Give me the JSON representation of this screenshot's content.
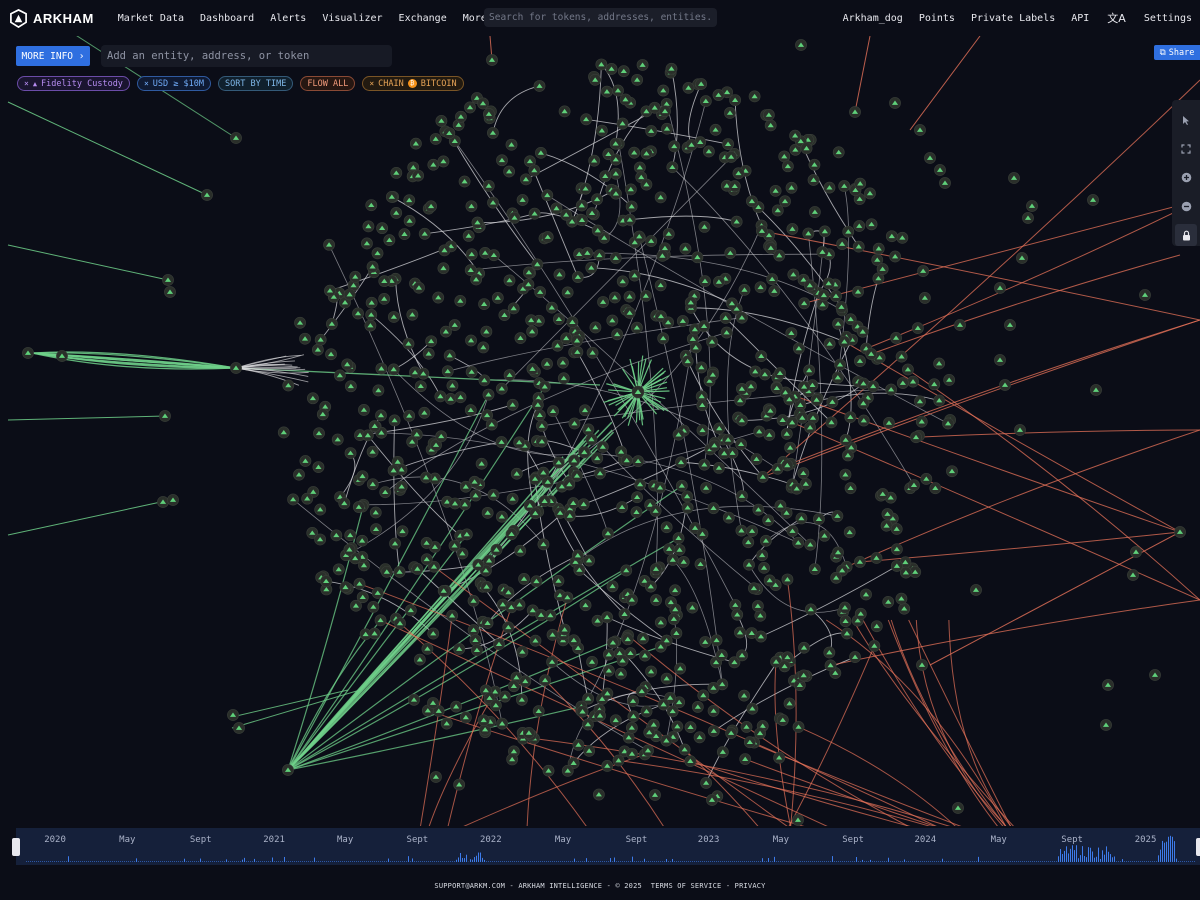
{
  "brand": {
    "name": "ARKHAM"
  },
  "nav": {
    "left": [
      "Market Data",
      "Dashboard",
      "Alerts",
      "Visualizer",
      "Exchange",
      "More"
    ],
    "search_placeholder": "Search for tokens, addresses, entities...",
    "right": [
      "Arkham_dog",
      "Points",
      "Private Labels",
      "API",
      "Settings"
    ],
    "translate_icon": "translate-icon"
  },
  "toolbar": {
    "more_info_label": "MORE INFO ›",
    "entity_input_placeholder": "Add an entity, address, or token",
    "share_label": "Share"
  },
  "filters": {
    "entity": "Fidelity Custody",
    "usd": "USD ≥ $10M",
    "sort": "SORT BY TIME",
    "flow": "FLOW ALL",
    "chain_prefix": "CHAIN",
    "chain_value": "BITCOIN",
    "remove_symbol": "×"
  },
  "tools": [
    "cursor-icon",
    "fit-icon",
    "zoom-in-icon",
    "zoom-out-icon",
    "lock-icon"
  ],
  "timeline": {
    "labels": [
      {
        "t": "2020",
        "x": 0.033
      },
      {
        "t": "May",
        "x": 0.094
      },
      {
        "t": "Sept",
        "x": 0.156
      },
      {
        "t": "2021",
        "x": 0.218
      },
      {
        "t": "May",
        "x": 0.278
      },
      {
        "t": "Sept",
        "x": 0.339
      },
      {
        "t": "2022",
        "x": 0.401
      },
      {
        "t": "May",
        "x": 0.462
      },
      {
        "t": "Sept",
        "x": 0.524
      },
      {
        "t": "2023",
        "x": 0.585
      },
      {
        "t": "May",
        "x": 0.646
      },
      {
        "t": "Sept",
        "x": 0.707
      },
      {
        "t": "2024",
        "x": 0.768
      },
      {
        "t": "May",
        "x": 0.83
      },
      {
        "t": "Sept",
        "x": 0.892
      },
      {
        "t": "2025",
        "x": 0.954
      }
    ]
  },
  "footer": {
    "support": "SUPPORT@ARKM.COM",
    "company": "ARKHAM INTELLIGENCE",
    "copyright": "© 2025",
    "terms": "TERMS OF SERVICE",
    "privacy": "PRIVACY",
    "sep": " - "
  },
  "colors": {
    "background": "#0b0d17",
    "node": "#2a2f2a",
    "node_logo": "#5fd07a",
    "edge_white": "#d8d8dc",
    "edge_green": "#6fd08a",
    "edge_red": "#e8735a",
    "accent_blue": "#2f6fe0"
  }
}
